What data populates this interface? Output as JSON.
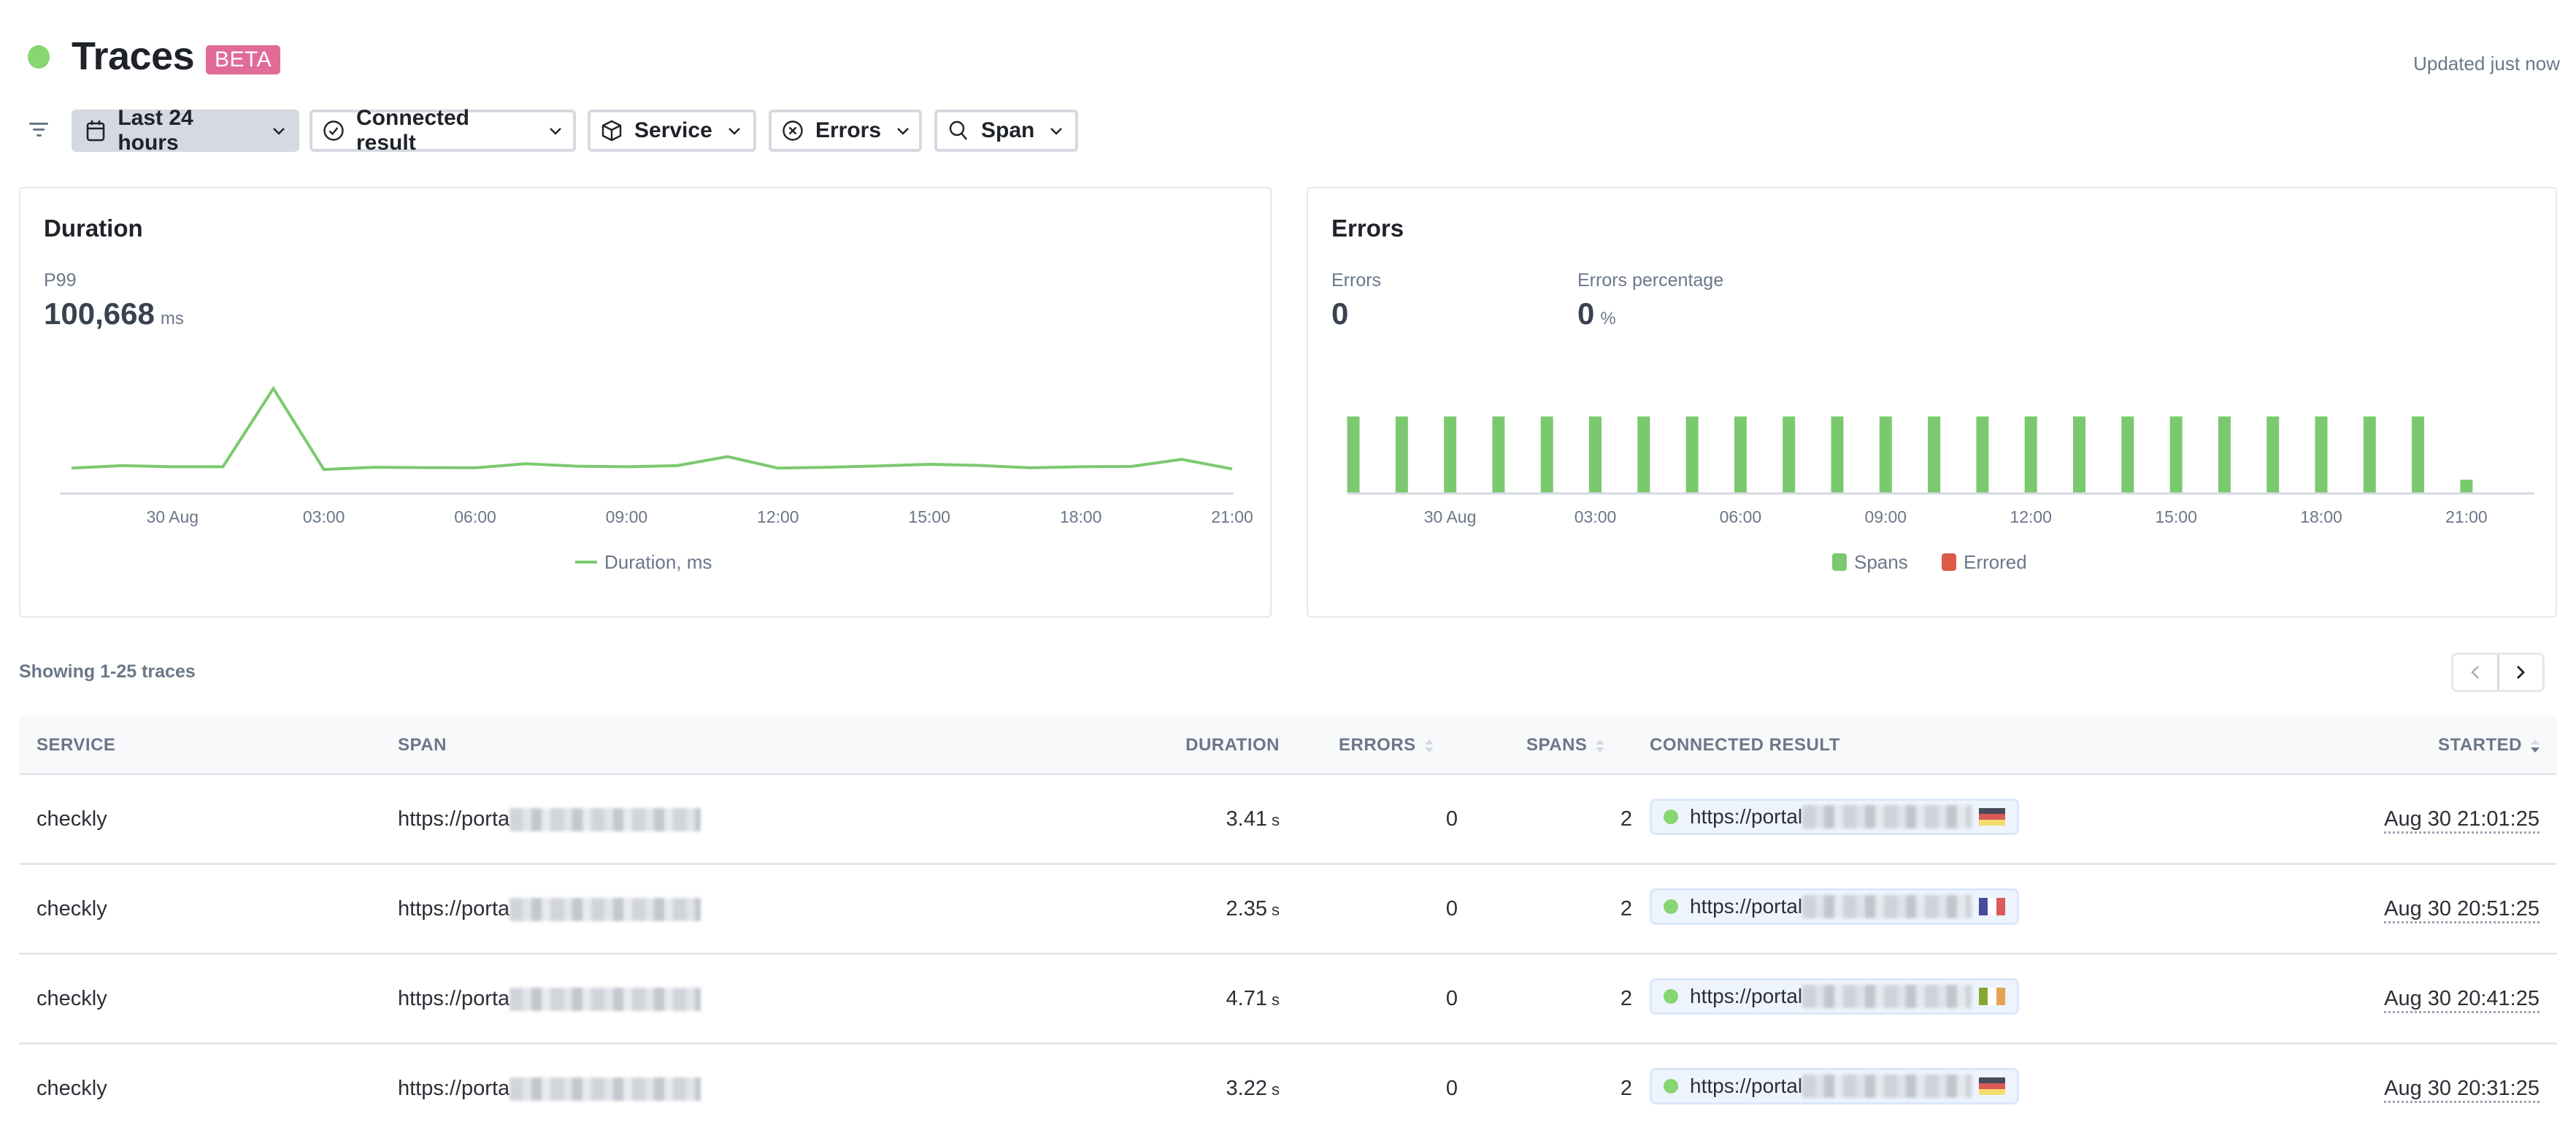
{
  "header": {
    "title": "Traces",
    "badge": "BETA",
    "updated": "Updated just now",
    "status_color": "#86d672"
  },
  "filters": [
    {
      "label": "Last 24 hours",
      "icon": "calendar-icon",
      "active": true
    },
    {
      "label": "Connected result",
      "icon": "check-circle-icon",
      "active": false
    },
    {
      "label": "Service",
      "icon": "cube-icon",
      "active": false
    },
    {
      "label": "Errors",
      "icon": "x-circle-icon",
      "active": false
    },
    {
      "label": "Span",
      "icon": "search-icon",
      "active": false
    }
  ],
  "duration_panel": {
    "title": "Duration",
    "stat_label": "P99",
    "stat_value": "100,668",
    "stat_unit": "ms"
  },
  "errors_panel": {
    "title": "Errors",
    "errors_label": "Errors",
    "errors_value": "0",
    "pct_label": "Errors percentage",
    "pct_value": "0",
    "pct_unit": "%"
  },
  "chart_data": [
    {
      "type": "line",
      "title": "Duration",
      "x": [
        "29 Aug 22:00",
        "23:00",
        "30 Aug 00:00",
        "01:00",
        "02:00",
        "03:00",
        "04:00",
        "05:00",
        "06:00",
        "07:00",
        "08:00",
        "09:00",
        "10:00",
        "11:00",
        "12:00",
        "13:00",
        "14:00",
        "15:00",
        "16:00",
        "17:00",
        "18:00",
        "19:00",
        "20:00",
        "21:00"
      ],
      "series": [
        {
          "name": "Duration, ms",
          "color": "#7bc96f",
          "values": [
            24300,
            26700,
            25600,
            25600,
            100668,
            23000,
            25100,
            24800,
            24600,
            28500,
            26200,
            25600,
            26700,
            35300,
            24300,
            25100,
            26400,
            28000,
            26900,
            24600,
            25600,
            25900,
            32700,
            23500
          ]
        }
      ],
      "xticks": [
        "30 Aug",
        "03:00",
        "06:00",
        "09:00",
        "12:00",
        "15:00",
        "18:00",
        "21:00"
      ],
      "xtick_indices": [
        2,
        5,
        8,
        11,
        14,
        17,
        20,
        23
      ],
      "ylim": [
        0,
        105000
      ],
      "grid": false,
      "legend": "bottom-center"
    },
    {
      "type": "bar",
      "title": "Errors",
      "x": [
        "29 Aug 22:00",
        "23:00",
        "30 Aug 00:00",
        "01:00",
        "02:00",
        "03:00",
        "04:00",
        "05:00",
        "06:00",
        "07:00",
        "08:00",
        "09:00",
        "10:00",
        "11:00",
        "12:00",
        "13:00",
        "14:00",
        "15:00",
        "16:00",
        "17:00",
        "18:00",
        "19:00",
        "20:00",
        "21:00"
      ],
      "series": [
        {
          "name": "Spans",
          "color": "#7bc96f",
          "values": [
            12,
            12,
            12,
            12,
            12,
            12,
            12,
            12,
            12,
            12,
            12,
            12,
            12,
            12,
            12,
            12,
            12,
            12,
            12,
            12,
            12,
            12,
            12,
            2
          ]
        },
        {
          "name": "Errored",
          "color": "#dc5a48",
          "values": [
            0,
            0,
            0,
            0,
            0,
            0,
            0,
            0,
            0,
            0,
            0,
            0,
            0,
            0,
            0,
            0,
            0,
            0,
            0,
            0,
            0,
            0,
            0,
            0
          ]
        }
      ],
      "xticks": [
        "30 Aug",
        "03:00",
        "06:00",
        "09:00",
        "12:00",
        "15:00",
        "18:00",
        "21:00"
      ],
      "xtick_indices": [
        2,
        5,
        8,
        11,
        14,
        17,
        20,
        23
      ],
      "ylim": [
        0,
        12
      ],
      "grid": false,
      "legend": "bottom-center"
    }
  ],
  "table": {
    "showing": "Showing 1-25 traces",
    "columns": {
      "service": "SERVICE",
      "span": "SPAN",
      "duration": "DURATION",
      "errors": "ERRORS",
      "spans": "SPANS",
      "connected": "CONNECTED RESULT",
      "started": "STARTED"
    },
    "rows": [
      {
        "service": "checkly",
        "span": "https://porta",
        "duration": "3.41",
        "duration_unit": "s",
        "errors": "0",
        "spans": "2",
        "connected": "https://portal",
        "flag": "de",
        "started": "Aug 30 21:01:25"
      },
      {
        "service": "checkly",
        "span": "https://porta",
        "duration": "2.35",
        "duration_unit": "s",
        "errors": "0",
        "spans": "2",
        "connected": "https://portal",
        "flag": "fr",
        "started": "Aug 30 20:51:25"
      },
      {
        "service": "checkly",
        "span": "https://porta",
        "duration": "4.71",
        "duration_unit": "s",
        "errors": "0",
        "spans": "2",
        "connected": "https://portal",
        "flag": "ie",
        "started": "Aug 30 20:41:25"
      },
      {
        "service": "checkly",
        "span": "https://porta",
        "duration": "3.22",
        "duration_unit": "s",
        "errors": "0",
        "spans": "2",
        "connected": "https://portal",
        "flag": "de",
        "started": "Aug 30 20:31:25"
      }
    ]
  }
}
